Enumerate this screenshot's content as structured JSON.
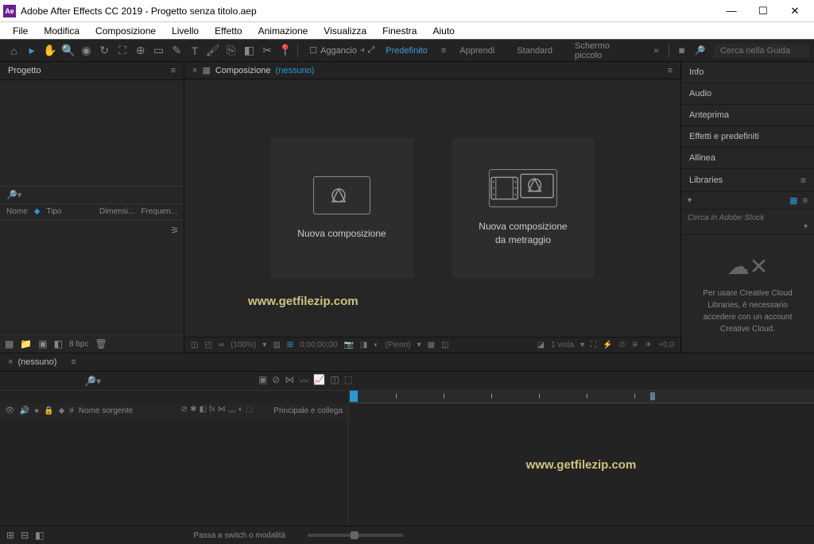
{
  "titlebar": {
    "app_icon": "Ae",
    "title": "Adobe After Effects CC 2019 - Progetto senza titolo.aep"
  },
  "menubar": [
    "File",
    "Modifica",
    "Composizione",
    "Livello",
    "Effetto",
    "Animazione",
    "Visualizza",
    "Finestra",
    "Aiuto"
  ],
  "toolbar": {
    "aggancio": "Aggancio",
    "workspaces": [
      "Predefinito",
      "Apprendi",
      "Standard",
      "Schermo piccolo"
    ],
    "active_workspace": 0,
    "search_placeholder": "Cerca nella Guida"
  },
  "project_panel": {
    "tab": "Progetto",
    "columns": {
      "name": "Nome",
      "type": "Tipo",
      "size": "Dimensi...",
      "freq": "Frequen..."
    },
    "bpc": "8 bpc"
  },
  "comp_panel": {
    "tab_prefix": "Composizione",
    "comp_name": "(nessuno)",
    "card1": "Nuova composizione",
    "card2_l1": "Nuova composizione",
    "card2_l2": "da metraggio",
    "footer": {
      "zoom": "(100%)",
      "timecode": "0:00;00;00",
      "quality": "(Pieno)",
      "view": "1 vista",
      "rot": "+0,0"
    }
  },
  "right_panels": {
    "items": [
      "Info",
      "Audio",
      "Anteprima",
      "Effetti e predefiniti",
      "Allinea",
      "Libraries"
    ],
    "libs_search_placeholder": "Cerca in Adobe Stock",
    "libs_msg": "Per usare Creative Cloud Libraries, è necessario accedere con un account Creative Cloud."
  },
  "timeline": {
    "tab": "(nessuno)",
    "col_hash": "#",
    "col_source": "Nome sorgente",
    "col_parent": "Principale e collega"
  },
  "statusbar": {
    "hint": "Passa a switch o modalità"
  },
  "watermark": "www.getfilezip.com"
}
